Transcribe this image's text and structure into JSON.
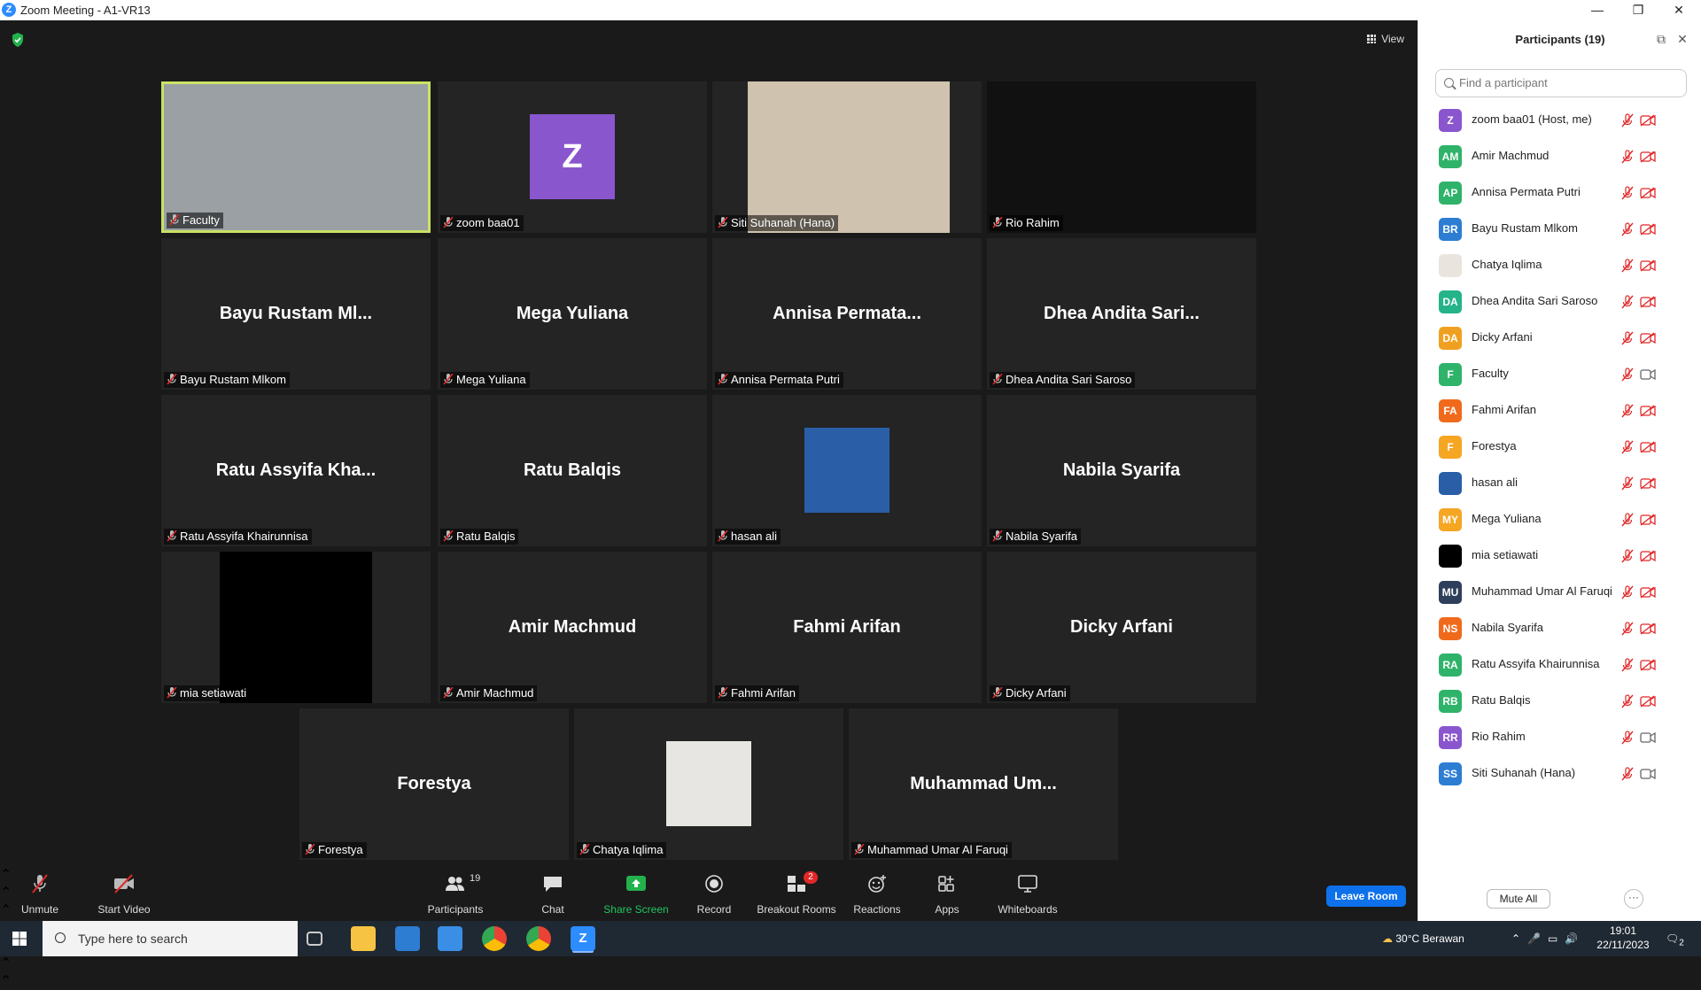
{
  "window": {
    "title": "Zoom Meeting - A1-VR13",
    "minimize": "—",
    "maximize": "❐",
    "close": "✕"
  },
  "stage": {
    "view_label": "View"
  },
  "tiles": [
    {
      "label": "Faculty",
      "type": "video",
      "bg": "#9aa0a4"
    },
    {
      "label": "zoom baa01",
      "type": "avatar",
      "avatar_letter": "Z",
      "avatar_color": "#8a56ce"
    },
    {
      "label": "Siti Suhanah (Hana)",
      "type": "video",
      "bg": "#cfc2ae"
    },
    {
      "label": "Rio Rahim",
      "type": "video",
      "bg": "#111"
    },
    {
      "label": "Bayu Rustam Mlkom",
      "type": "name",
      "display": "Bayu Rustam Ml..."
    },
    {
      "label": "Mega Yuliana",
      "type": "name",
      "display": "Mega Yuliana"
    },
    {
      "label": "Annisa Permata Putri",
      "type": "name",
      "display": "Annisa  Permata..."
    },
    {
      "label": "Dhea Andita Sari Saroso",
      "type": "name",
      "display": "Dhea  Andita  Sari..."
    },
    {
      "label": "Ratu Assyifa Khairunnisa",
      "type": "name",
      "display": "Ratu  Assyifa  Kha..."
    },
    {
      "label": "Ratu Balqis",
      "type": "name",
      "display": "Ratu Balqis"
    },
    {
      "label": "hasan ali",
      "type": "photo",
      "bg": "#2a5fa8"
    },
    {
      "label": "Nabila Syarifa",
      "type": "name",
      "display": "Nabila Syarifa"
    },
    {
      "label": "mia setiawati",
      "type": "black"
    },
    {
      "label": "Amir Machmud",
      "type": "name",
      "display": "Amir Machmud"
    },
    {
      "label": "Fahmi Arifan",
      "type": "name",
      "display": "Fahmi Arifan"
    },
    {
      "label": "Dicky Arfani",
      "type": "name",
      "display": "Dicky Arfani"
    },
    {
      "label": "Forestya",
      "type": "name",
      "display": "Forestya"
    },
    {
      "label": "Chatya Iqlima",
      "type": "photo",
      "bg": "#e8e6e2"
    },
    {
      "label": "Muhammad Umar Al Faruqi",
      "type": "name",
      "display": "Muhammad  Um..."
    }
  ],
  "panel": {
    "title": "Participants (19)",
    "search_placeholder": "Find a participant",
    "mute_all": "Mute All",
    "more": "···",
    "participants": [
      {
        "initials": "Z",
        "name": "zoom baa01 (Host, me)",
        "color": "#8a56ce",
        "video": "off"
      },
      {
        "initials": "AM",
        "name": "Amir Machmud",
        "color": "#2fb36b",
        "video": "off"
      },
      {
        "initials": "AP",
        "name": "Annisa Permata Putri",
        "color": "#2fb36b",
        "video": "off"
      },
      {
        "initials": "BR",
        "name": "Bayu Rustam Mlkom",
        "color": "#2d7dd2",
        "video": "off"
      },
      {
        "initials": "",
        "name": "Chatya Iqlima",
        "color": "#e9e4de",
        "video": "off"
      },
      {
        "initials": "DA",
        "name": "Dhea Andita Sari Saroso",
        "color": "#25b38a",
        "video": "off"
      },
      {
        "initials": "DA",
        "name": "Dicky Arfani",
        "color": "#f0a020",
        "video": "off"
      },
      {
        "initials": "F",
        "name": "Faculty",
        "color": "#2fb36b",
        "video": "on"
      },
      {
        "initials": "FA",
        "name": "Fahmi Arifan",
        "color": "#f06a1c",
        "video": "off"
      },
      {
        "initials": "F",
        "name": "Forestya",
        "color": "#f5a623",
        "video": "off"
      },
      {
        "initials": "",
        "name": "hasan ali",
        "color": "#2a5fa8",
        "video": "off"
      },
      {
        "initials": "MY",
        "name": "Mega Yuliana",
        "color": "#f5a623",
        "video": "off"
      },
      {
        "initials": "",
        "name": "mia setiawati",
        "color": "#000000",
        "video": "off"
      },
      {
        "initials": "MU",
        "name": "Muhammad Umar Al Faruqi",
        "color": "#2e3f5c",
        "video": "off"
      },
      {
        "initials": "NS",
        "name": "Nabila Syarifa",
        "color": "#f06a1c",
        "video": "off"
      },
      {
        "initials": "RA",
        "name": "Ratu Assyifa Khairunnisa",
        "color": "#2fb36b",
        "video": "off"
      },
      {
        "initials": "RB",
        "name": "Ratu Balqis",
        "color": "#2fb36b",
        "video": "off"
      },
      {
        "initials": "RR",
        "name": "Rio Rahim",
        "color": "#8a56ce",
        "video": "on"
      },
      {
        "initials": "SS",
        "name": "Siti Suhanah (Hana)",
        "color": "#2d7dd2",
        "video": "on"
      }
    ]
  },
  "toolbar": {
    "unmute": "Unmute",
    "start_video": "Start Video",
    "participants": "Participants",
    "participants_count": "19",
    "chat": "Chat",
    "share_screen": "Share Screen",
    "record": "Record",
    "breakout_rooms": "Breakout Rooms",
    "breakout_badge": "2",
    "reactions": "Reactions",
    "apps": "Apps",
    "whiteboards": "Whiteboards",
    "leave": "Leave Room"
  },
  "taskbar": {
    "search_placeholder": "Type here to search",
    "weather": "30°C  Berawan",
    "time": "19:01",
    "date": "22/11/2023",
    "notif_count": "2"
  }
}
